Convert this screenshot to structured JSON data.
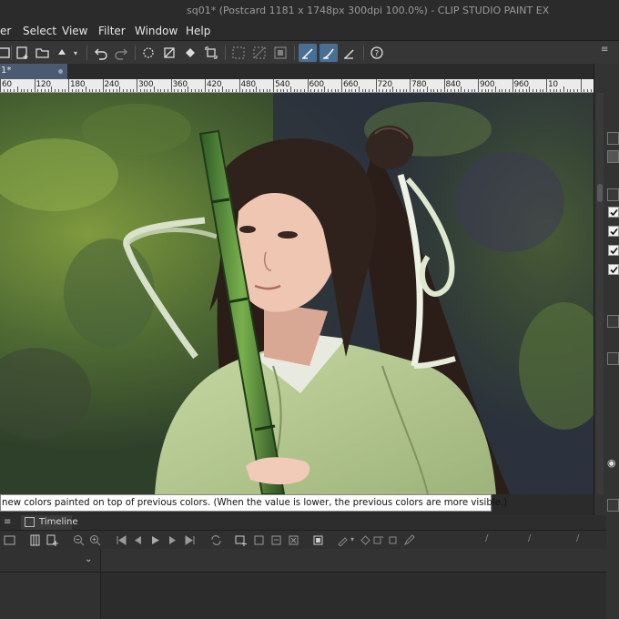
{
  "window": {
    "title": "sq01* (Postcard 1181 x 1748px 300dpi 100.0%)  - CLIP STUDIO PAINT EX"
  },
  "menu": {
    "items": [
      "er",
      "Select",
      "View",
      "Filter",
      "Window",
      "Help"
    ]
  },
  "tab": {
    "label": "1*"
  },
  "ruler": {
    "labels": [
      "60",
      "120",
      "180",
      "240",
      "300",
      "360",
      "420",
      "480",
      "540",
      "600",
      "660",
      "720",
      "780",
      "840",
      "900",
      "960",
      "10"
    ]
  },
  "tooltip": {
    "text": " new colors painted on top of previous colors. (When the value is lower, the previous colors are more visible.)"
  },
  "timeline": {
    "tab_label": "Timeline"
  },
  "colors": {
    "accent": "#4a6f95",
    "tab_active": "#4b5a71",
    "background": "#2b2b2b"
  }
}
